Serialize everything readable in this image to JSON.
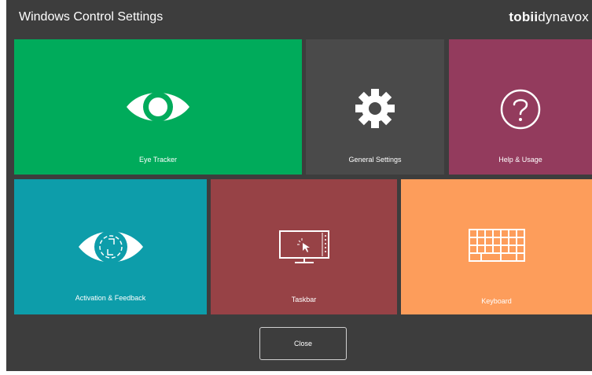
{
  "window": {
    "title": "Windows Control Settings"
  },
  "brand": {
    "part1": "tobii",
    "part2": "dynavox"
  },
  "tiles": [
    {
      "label": "Eye Tracker",
      "color": "#00ab5b",
      "icon": "eye-icon"
    },
    {
      "label": "General Settings",
      "color": "#4a4a4a",
      "icon": "gear-icon"
    },
    {
      "label": "Help & Usage",
      "color": "#933b5d",
      "icon": "question-mark-icon"
    },
    {
      "label": "Activation & Feedback",
      "color": "#0d9daa",
      "icon": "eye-activation-icon"
    },
    {
      "label": "Taskbar",
      "color": "#974246",
      "icon": "taskbar-monitor-icon"
    },
    {
      "label": "Keyboard",
      "color": "#fd9d5b",
      "icon": "keyboard-icon"
    }
  ],
  "footer": {
    "close_label": "Close"
  },
  "colors": {
    "background": "#3d3d3d",
    "text": "#ffffff"
  }
}
